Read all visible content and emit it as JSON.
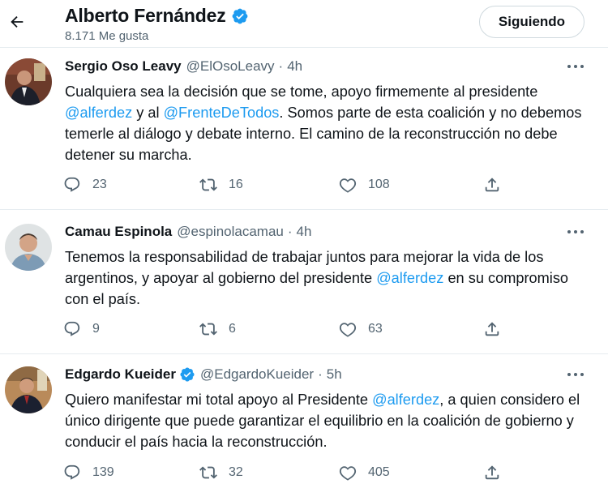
{
  "header": {
    "title": "Alberto Fernández",
    "subtitle": "8.171 Me gusta",
    "follow_label": "Siguiendo"
  },
  "tweets": [
    {
      "name": "Sergio Oso Leavy",
      "handle": "@ElOsoLeavy",
      "dot": "·",
      "time": "4h",
      "verified": false,
      "text_parts": [
        {
          "t": "Cualquiera sea la decisión que se tome, apoyo firmemente al presidente "
        },
        {
          "t": "@alferdez",
          "m": true
        },
        {
          "t": " y al "
        },
        {
          "t": "@FrenteDeTodos",
          "m": true
        },
        {
          "t": ". Somos parte de esta coalición y no debemos temerle al diálogo y debate interno. El camino de la reconstrucción no debe detener su marcha."
        }
      ],
      "replies": "23",
      "retweets": "16",
      "likes": "108"
    },
    {
      "name": "Camau Espinola",
      "handle": "@espinolacamau",
      "dot": "·",
      "time": "4h",
      "verified": false,
      "text_parts": [
        {
          "t": "Tenemos la responsabilidad de trabajar juntos para mejorar la vida de los argentinos, y apoyar al gobierno del presidente "
        },
        {
          "t": "@alferdez",
          "m": true
        },
        {
          "t": " en su compromiso con el país."
        }
      ],
      "replies": "9",
      "retweets": "6",
      "likes": "63"
    },
    {
      "name": "Edgardo Kueider",
      "handle": "@EdgardoKueider",
      "dot": "·",
      "time": "5h",
      "verified": true,
      "text_parts": [
        {
          "t": "Quiero manifestar mi total apoyo al Presidente "
        },
        {
          "t": "@alferdez",
          "m": true
        },
        {
          "t": ", a quien considero el único dirigente que puede garantizar el equilibrio en la coalición de gobierno y conducir el país hacia la reconstrucción."
        }
      ],
      "replies": "139",
      "retweets": "32",
      "likes": "405"
    }
  ],
  "icons": {
    "back": "arrow-left-icon",
    "verified": "verified-badge-icon",
    "more": "more-dots-icon",
    "reply": "reply-icon",
    "retweet": "retweet-icon",
    "like": "heart-icon",
    "share": "share-icon"
  },
  "colors": {
    "mention": "#1d9bf0",
    "secondary_text": "#536471",
    "verified": "#1d9bf0",
    "divider": "#e6ecf0"
  }
}
